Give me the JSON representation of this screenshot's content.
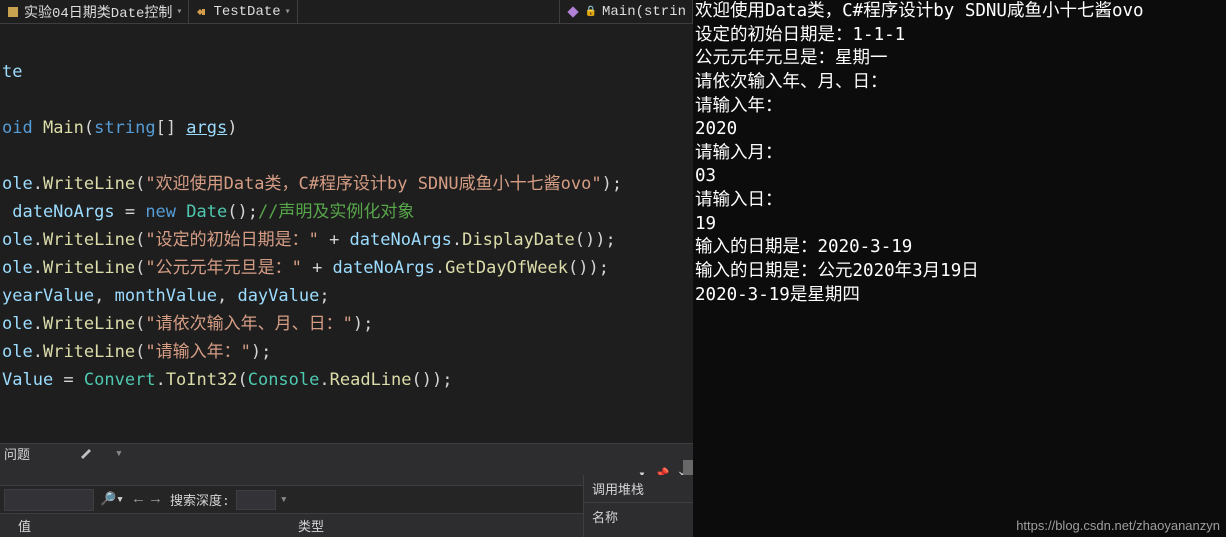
{
  "breadcrumb": {
    "item1_label": "实验04日期类Date控制",
    "item2_label": "TestDate",
    "item3_label": "Main(strin"
  },
  "code": {
    "l3": "te",
    "l5a": "oid ",
    "l5b": "Main",
    "l5c": "(",
    "l5d": "string",
    "l5e": "[] ",
    "l5f": "args",
    "l5g": ")",
    "l7a": "ole",
    "l7b": ".",
    "l7c": "WriteLine",
    "l7d": "(",
    "l7e": "\"欢迎使用Data类，C#程序设计by SDNU咸鱼小十七酱ovo\"",
    "l7f": ");",
    "l8a": " dateNoArgs ",
    "l8b": "= ",
    "l8c": "new ",
    "l8d": "Date",
    "l8e": "();",
    "l8f": "//声明及实例化对象",
    "l9a": "ole",
    "l9b": ".",
    "l9c": "WriteLine",
    "l9d": "(",
    "l9e": "\"设定的初始日期是：\" ",
    "l9f": "+ ",
    "l9g": "dateNoArgs",
    "l9h": ".",
    "l9i": "DisplayDate",
    "l9j": "());",
    "l10a": "ole",
    "l10b": ".",
    "l10c": "WriteLine",
    "l10d": "(",
    "l10e": "\"公元元年元旦是：\" ",
    "l10f": "+ ",
    "l10g": "dateNoArgs",
    "l10h": ".",
    "l10i": "GetDayOfWeek",
    "l10j": "());",
    "l11a": "yearValue",
    "l11b": ", ",
    "l11c": "monthValue",
    "l11d": ", ",
    "l11e": "dayValue",
    "l11f": ";",
    "l12a": "ole",
    "l12b": ".",
    "l12c": "WriteLine",
    "l12d": "(",
    "l12e": "\"请依次输入年、月、日：\"",
    "l12f": ");",
    "l13a": "ole",
    "l13b": ".",
    "l13c": "WriteLine",
    "l13d": "(",
    "l13e": "\"请输入年：\"",
    "l13f": ");",
    "l14a": "Value ",
    "l14b": "= ",
    "l14c": "Convert",
    "l14d": ".",
    "l14e": "ToInt32",
    "l14f": "(",
    "l14g": "Console",
    "l14h": ".",
    "l14i": "ReadLine",
    "l14j": "());"
  },
  "bottom": {
    "tab1": "问题",
    "search_depth_label": "搜索深度:",
    "col_value": "值",
    "col_type": "类型",
    "callstack_title": "调用堆栈",
    "callstack_col": "名称"
  },
  "console": {
    "l1": "欢迎使用Data类，C#程序设计by SDNU咸鱼小十七酱ovo",
    "l2": "设定的初始日期是：1-1-1",
    "l3": "公元元年元旦是：星期一",
    "l4": "请依次输入年、月、日：",
    "l5": "请输入年：",
    "l6": "2020",
    "l7": "请输入月：",
    "l8": "03",
    "l9": "请输入日：",
    "l10": "19",
    "l11": "输入的日期是：2020-3-19",
    "l12": "输入的日期是：公元2020年3月19日",
    "l13": "2020-3-19是星期四"
  },
  "watermark": "https://blog.csdn.net/zhaoyananzyn"
}
